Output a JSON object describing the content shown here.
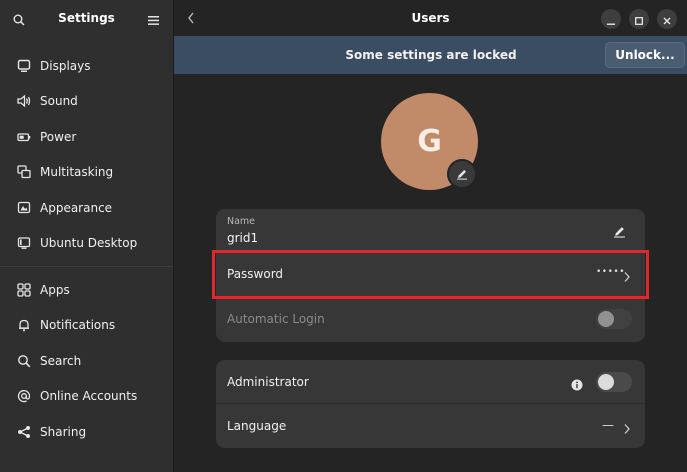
{
  "sidebar": {
    "title": "Settings",
    "items": [
      {
        "label": "Displays",
        "icon": "display-icon"
      },
      {
        "label": "Sound",
        "icon": "speaker-icon"
      },
      {
        "label": "Power",
        "icon": "power-icon"
      },
      {
        "label": "Multitasking",
        "icon": "multitasking-icon"
      },
      {
        "label": "Appearance",
        "icon": "appearance-icon"
      },
      {
        "label": "Ubuntu Desktop",
        "icon": "ubuntu-desktop-icon"
      },
      {
        "label": "Apps",
        "icon": "apps-grid-icon"
      },
      {
        "label": "Notifications",
        "icon": "bell-icon"
      },
      {
        "label": "Search",
        "icon": "search-icon"
      },
      {
        "label": "Online Accounts",
        "icon": "at-sign-icon"
      },
      {
        "label": "Sharing",
        "icon": "share-icon"
      }
    ]
  },
  "window": {
    "title": "Users"
  },
  "banner": {
    "text": "Some settings are locked",
    "unlock_label": "Unlock..."
  },
  "user": {
    "avatar_initial": "G",
    "avatar_color": "#c18a68",
    "name_label": "Name",
    "name_value": "grid1",
    "password_label": "Password",
    "password_value": "•••••",
    "autologin_label": "Automatic Login",
    "autologin_on": false
  },
  "account": {
    "admin_label": "Administrator",
    "admin_on": false,
    "language_label": "Language",
    "language_value": "—"
  },
  "highlight_color": "#e3262c"
}
